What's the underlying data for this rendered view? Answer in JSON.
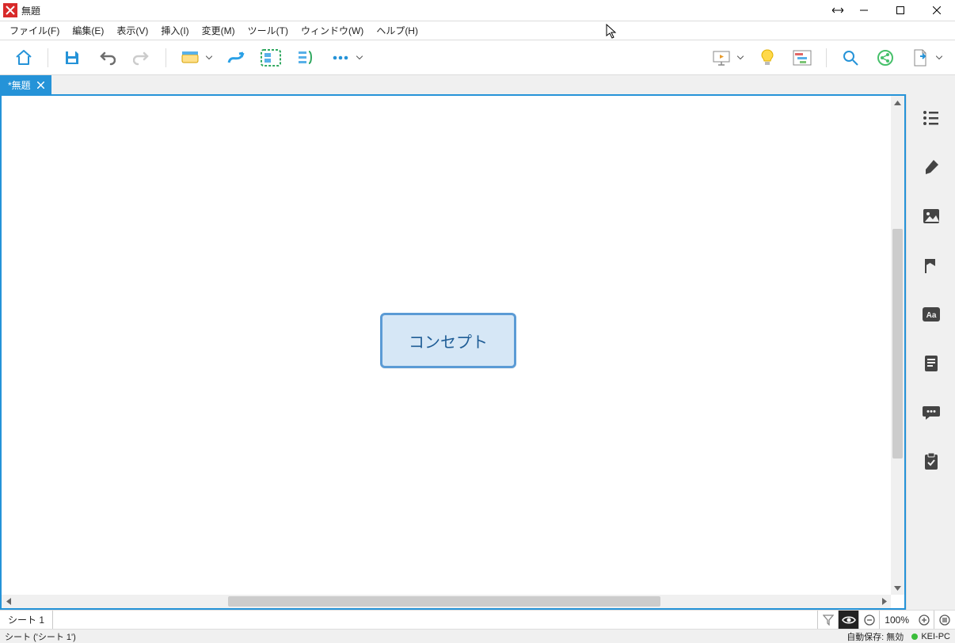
{
  "window": {
    "title": "無題"
  },
  "menu": {
    "file": "ファイル(F)",
    "edit": "編集(E)",
    "view": "表示(V)",
    "insert": "挿入(I)",
    "modify": "変更(M)",
    "tools": "ツール(T)",
    "window": "ウィンドウ(W)",
    "help": "ヘルプ(H)"
  },
  "tab": {
    "name": "*無題"
  },
  "canvas": {
    "central_topic": "コンセプト"
  },
  "sheet": {
    "tab": "シート 1",
    "zoom": "100%"
  },
  "status": {
    "sheet_path": "シート ('シート 1')",
    "autosave": "自動保存: 無効",
    "host": "KEI-PC"
  }
}
